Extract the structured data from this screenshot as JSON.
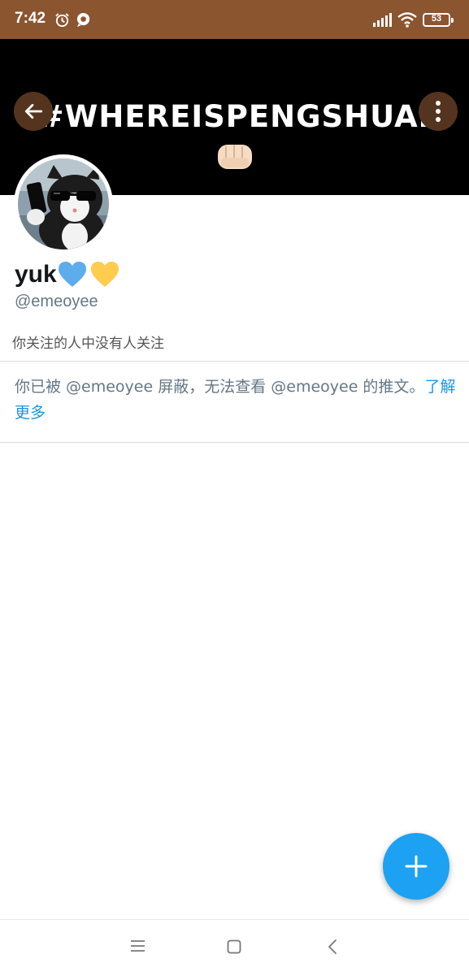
{
  "status_bar": {
    "time": "7:42",
    "battery": "53",
    "icons": [
      "alarm-icon",
      "app-notification-icon",
      "signal-icon",
      "wifi-icon",
      "battery-icon"
    ]
  },
  "header": {
    "banner_text": "#WHEREISPENGSHUAI",
    "banner_emoji": "fist-icon",
    "back_icon": "back-arrow-icon",
    "more_icon": "more-vertical-icon"
  },
  "profile": {
    "name": "yuk",
    "name_emojis": [
      "blue-heart-icon",
      "yellow-heart-icon"
    ],
    "handle": "@emeoyee",
    "follows_note": "你关注的人中没有人关注"
  },
  "blocked_notice": {
    "text": "你已被 @emeoyee 屏蔽，无法查看 @emeoyee 的推文。",
    "link": "了解更多"
  },
  "fab": {
    "icon": "plus-icon"
  },
  "nav_bar": {
    "icons": [
      "menu-icon",
      "home-icon",
      "back-icon"
    ]
  },
  "colors": {
    "status_bar": "#8b5530",
    "banner": "#000000",
    "accent": "#1da1f2",
    "link": "#1b95e0",
    "secondary_text": "#657786"
  }
}
